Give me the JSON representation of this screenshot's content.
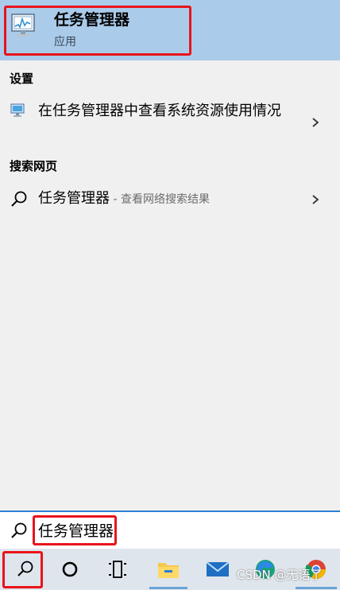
{
  "best_match": {
    "title": "任务管理器",
    "subtitle": "应用",
    "icon": "task-manager-icon"
  },
  "settings": {
    "header": "设置",
    "item_label": "在任务管理器中查看系统资源使用情况",
    "icon": "monitor-icon"
  },
  "web": {
    "header": "搜索网页",
    "item_query": "任务管理器",
    "item_hint": " - 查看网络搜索结果",
    "icon": "search-icon"
  },
  "search_box": {
    "value": "任务管理器",
    "icon": "search-icon"
  },
  "taskbar": {
    "items": [
      {
        "name": "search-button",
        "icon": "search-icon"
      },
      {
        "name": "cortana-button",
        "icon": "circle-icon"
      },
      {
        "name": "task-view-button",
        "icon": "task-view-icon"
      },
      {
        "name": "file-explorer-button",
        "icon": "folder-icon"
      },
      {
        "name": "mail-button",
        "icon": "mail-icon"
      },
      {
        "name": "edge-button",
        "icon": "edge-icon"
      },
      {
        "name": "chrome-button",
        "icon": "chrome-icon"
      }
    ]
  },
  "watermark": "CSDN @无语了",
  "colors": {
    "best_match_bg": "#aacbea",
    "panel_bg": "#f0f0f0",
    "highlight_red": "#e8141a",
    "search_border": "#2c80d3",
    "taskbar_bg": "#dfe5ec"
  }
}
